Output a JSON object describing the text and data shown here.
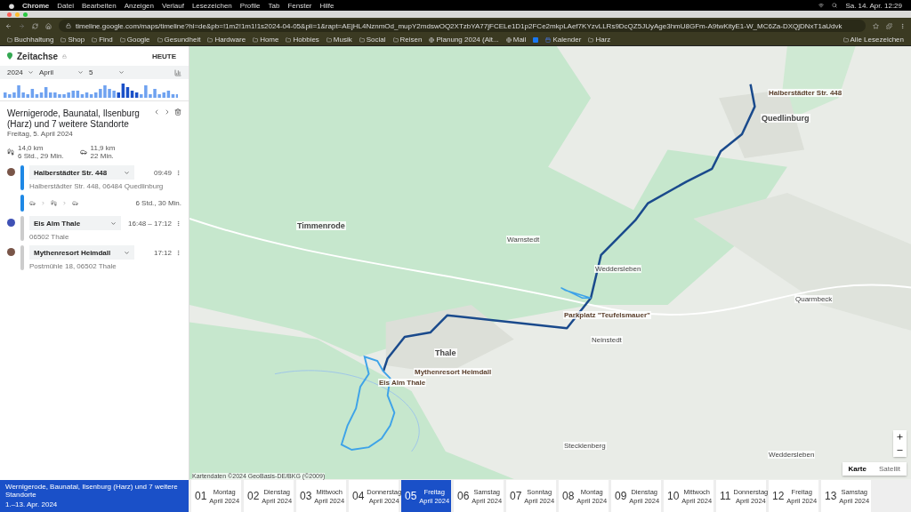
{
  "menubar": {
    "items": [
      "Chrome",
      "Datei",
      "Bearbeiten",
      "Anzeigen",
      "Verlauf",
      "Lesezeichen",
      "Profile",
      "Tab",
      "Fenster",
      "Hilfe"
    ],
    "clock": "Sa. 14. Apr. 12:29"
  },
  "browser": {
    "url": "timeline.google.com/maps/timeline?hl=de&pb=!1m2!1m1!1s2024-04-05&pli=1&rapt=AEjHL4NznmOd_mupY2mdswOQ2XTzbYA77jFCELe1D1p2FCe2mkpLAef7KYzvLLRs9DcQZ5JUyAge3hmU8GFm-A9twKityE1-W_MC6Za-DXQjDNxT1aUdvk",
    "bookmarks": [
      {
        "label": "Buchhaltung",
        "kind": "folder"
      },
      {
        "label": "Shop",
        "kind": "folder"
      },
      {
        "label": "Find",
        "kind": "folder"
      },
      {
        "label": "Google",
        "kind": "folder"
      },
      {
        "label": "Gesundheit",
        "kind": "folder"
      },
      {
        "label": "Hardware",
        "kind": "folder"
      },
      {
        "label": "Home",
        "kind": "folder"
      },
      {
        "label": "Hobbies",
        "kind": "folder"
      },
      {
        "label": "Musik",
        "kind": "folder"
      },
      {
        "label": "Social",
        "kind": "folder"
      },
      {
        "label": "Reisen",
        "kind": "folder"
      },
      {
        "label": "Planung 2024 (Alt...",
        "kind": "site"
      },
      {
        "label": "Mail",
        "kind": "site"
      },
      {
        "kind": "facebook"
      },
      {
        "label": "Kalender",
        "kind": "calendar"
      },
      {
        "label": "Harz",
        "kind": "folder"
      }
    ],
    "all_bookmarks": "Alle Lesezeichen"
  },
  "sidebar": {
    "title": "Zeitachse",
    "today": "HEUTE",
    "selects": [
      "2024",
      "April",
      "5"
    ],
    "day_title": "Wernigerode, Baunatal, Ilsenburg (Harz) und 7 weitere Standorte",
    "day_date": "Freitag, 5. April 2024",
    "summary": [
      {
        "kind": "walk",
        "distance": "14,0 km",
        "duration": "6 Std., 29 Min."
      },
      {
        "kind": "car",
        "distance": "11,9 km",
        "duration": "22 Min."
      }
    ],
    "timeline": [
      {
        "kind": "place",
        "name": "Halberstädter Str. 448",
        "time": "09:49",
        "address": "Halberstädter Str. 448, 06484 Quedlinburg",
        "color": "#795548"
      },
      {
        "kind": "movement",
        "duration": "6 Std., 30 Min."
      },
      {
        "kind": "place",
        "name": "Eis Alm Thale",
        "time": "16:48 – 17:12",
        "address": "06502 Thale",
        "color": "#3f51b5"
      },
      {
        "kind": "place",
        "name": "Mythenresort Heimdall",
        "time": "17:12",
        "address": "Postmühle 18, 06502 Thale",
        "color": "#795548"
      }
    ]
  },
  "map": {
    "labels": [
      {
        "text": "Halberstädter Str. 448",
        "kind": "pin"
      },
      {
        "text": "Quedlinburg",
        "kind": "town"
      },
      {
        "text": "Timmenrode",
        "kind": "town"
      },
      {
        "text": "Warnstedt",
        "kind": "village"
      },
      {
        "text": "Weddersleben",
        "kind": "village"
      },
      {
        "text": "Parkplatz \"Teufelsmauer\"",
        "kind": "pin"
      },
      {
        "text": "Neinstedt",
        "kind": "village"
      },
      {
        "text": "Thale",
        "kind": "town"
      },
      {
        "text": "Mythenresort Heimdall",
        "kind": "pin"
      },
      {
        "text": "Eis Alm Thale",
        "kind": "pin"
      },
      {
        "text": "Quarmbeck",
        "kind": "village"
      },
      {
        "text": "Stecklenberg",
        "kind": "village"
      },
      {
        "text": "Weddersleben",
        "kind": "village"
      }
    ],
    "attribution": "Kartendaten ©2024 GeoBasis-DE/BKG (©2009)",
    "types": [
      {
        "label": "Karte",
        "selected": true
      },
      {
        "label": "Satellit",
        "selected": false
      }
    ]
  },
  "strip": {
    "range_title": "Wernigerode, Baunatal, Ilsenburg (Harz) und 7 weitere Standorte",
    "range_dates": "1.–13. Apr. 2024",
    "range_selected": true,
    "days": [
      {
        "num": "01",
        "weekday": "Montag",
        "month": "April 2024",
        "selected": false
      },
      {
        "num": "02",
        "weekday": "Dienstag",
        "month": "April 2024",
        "selected": false
      },
      {
        "num": "03",
        "weekday": "Mittwoch",
        "month": "April 2024",
        "selected": false
      },
      {
        "num": "04",
        "weekday": "Donnerstag",
        "month": "April 2024",
        "selected": false
      },
      {
        "num": "05",
        "weekday": "Freitag",
        "month": "April 2024",
        "selected": true
      },
      {
        "num": "06",
        "weekday": "Samstag",
        "month": "April 2024",
        "selected": false
      },
      {
        "num": "07",
        "weekday": "Sonntag",
        "month": "April 2024",
        "selected": false
      },
      {
        "num": "08",
        "weekday": "Montag",
        "month": "April 2024",
        "selected": false
      },
      {
        "num": "09",
        "weekday": "Dienstag",
        "month": "April 2024",
        "selected": false
      },
      {
        "num": "10",
        "weekday": "Mittwoch",
        "month": "April 2024",
        "selected": false
      },
      {
        "num": "11",
        "weekday": "Donnerstag",
        "month": "April 2024",
        "selected": false
      },
      {
        "num": "12",
        "weekday": "Freitag",
        "month": "April 2024",
        "selected": false
      },
      {
        "num": "13",
        "weekday": "Samstag",
        "month": "April 2024",
        "selected": false
      }
    ]
  }
}
